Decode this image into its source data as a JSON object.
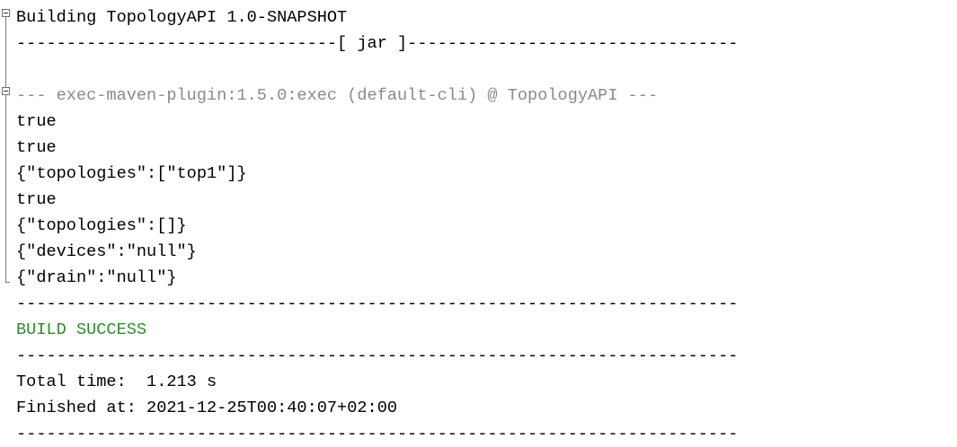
{
  "console": {
    "lines": [
      "Building TopologyAPI 1.0-SNAPSHOT",
      "--------------------------------[ jar ]---------------------------------",
      "",
      "--- exec-maven-plugin:1.5.0:exec (default-cli) @ TopologyAPI ---",
      "true",
      "true",
      "{\"topologies\":[\"top1\"]}",
      "true",
      "{\"topologies\":[]}",
      "{\"devices\":\"null\"}",
      "{\"drain\":\"null\"}",
      "------------------------------------------------------------------------",
      "BUILD SUCCESS",
      "------------------------------------------------------------------------",
      "Total time:  1.213 s",
      "Finished at: 2021-12-25T00:40:07+02:00",
      "------------------------------------------------------------------------"
    ]
  },
  "colors": {
    "plugin_line": "#8a8a8a",
    "build_success": "#2e8b2e",
    "text": "#000000"
  },
  "icons": [
    "fold-collapse-icon"
  ]
}
